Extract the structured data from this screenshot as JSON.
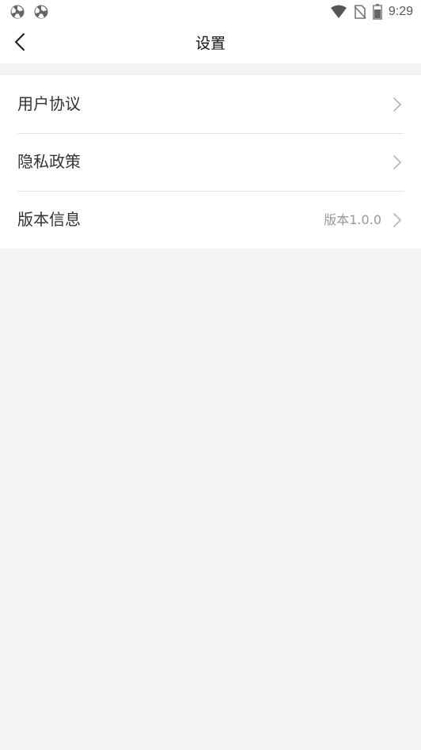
{
  "status_bar": {
    "time": "9:29",
    "left_icons": [
      "app-notification-icon",
      "app-notification-icon"
    ],
    "right_icons": [
      "wifi-icon",
      "no-sim-icon",
      "battery-icon"
    ]
  },
  "header": {
    "title": "设置",
    "back_icon": "chevron-left-icon"
  },
  "settings": {
    "items": [
      {
        "label": "用户协议",
        "value": ""
      },
      {
        "label": "隐私政策",
        "value": ""
      },
      {
        "label": "版本信息",
        "value": "版本1.0.0"
      }
    ]
  },
  "colors": {
    "page_background": "#f3f3f3",
    "surface": "#ffffff",
    "divider": "#e4e4e4",
    "text_primary": "#333333",
    "text_secondary": "#999999"
  }
}
